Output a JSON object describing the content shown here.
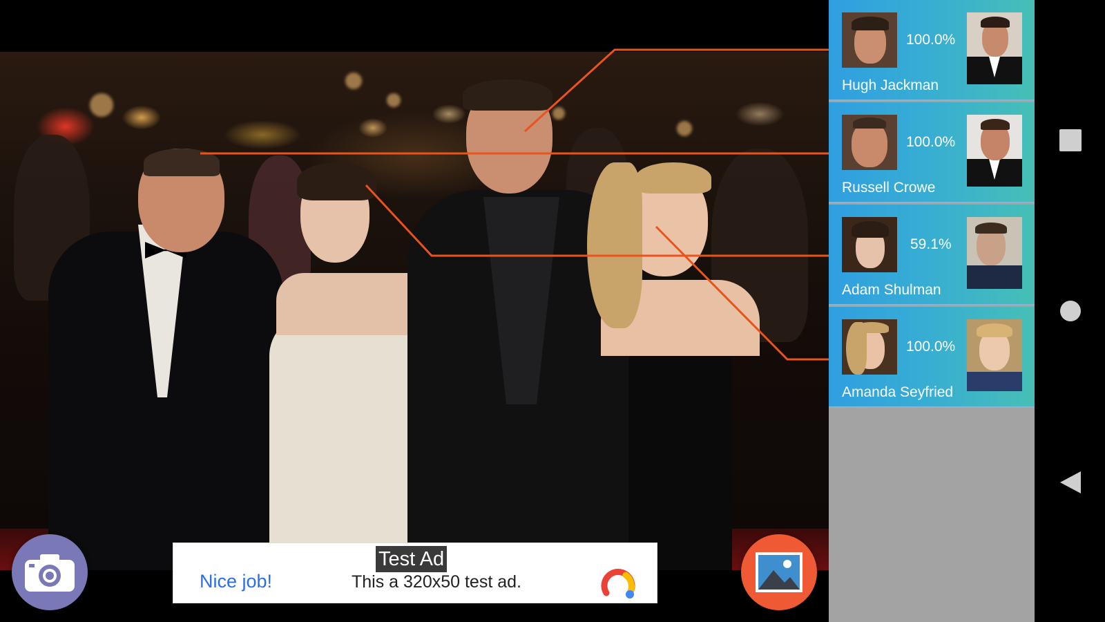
{
  "results": [
    {
      "name": "Hugh Jackman",
      "confidence": "100.0%"
    },
    {
      "name": "Russell Crowe",
      "confidence": "100.0%"
    },
    {
      "name": "Adam Shulman",
      "confidence": "59.1%"
    },
    {
      "name": "Amanda Seyfried",
      "confidence": "100.0%"
    }
  ],
  "ad": {
    "label": "Test Ad",
    "headline": "Nice job!",
    "body": "This a 320x50 test ad."
  },
  "buttons": {
    "camera_icon": "camera-icon",
    "gallery_icon": "image-icon"
  },
  "navigation": {
    "recents_icon": "square-icon",
    "home_icon": "circle-icon",
    "back_icon": "triangle-back-icon"
  },
  "colors": {
    "card_gradient_start": "#2f9fe0",
    "card_gradient_end": "#47bfb6",
    "panel_background": "#a3a3a3",
    "detection_line": "#e8531e",
    "camera_button": "#7b78b8",
    "gallery_button": "#ef5a34",
    "ad_headline": "#2a6fe8"
  }
}
